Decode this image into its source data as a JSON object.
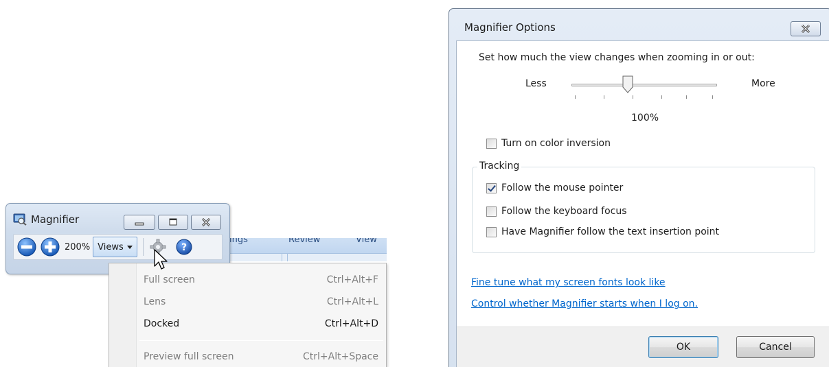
{
  "magnifier": {
    "title": "Magnifier",
    "zoom_level": "200%",
    "views_label": "Views"
  },
  "ribbon_bg": {
    "labels": [
      "ings",
      "Review",
      "View"
    ]
  },
  "views_menu": {
    "items": [
      {
        "label": "Full screen",
        "shortcut": "Ctrl+Alt+F",
        "enabled": false
      },
      {
        "label": "Lens",
        "shortcut": "Ctrl+Alt+L",
        "enabled": false
      },
      {
        "label": "Docked",
        "shortcut": "Ctrl+Alt+D",
        "enabled": true
      },
      {
        "label": "Preview full screen",
        "shortcut": "Ctrl+Alt+Space",
        "enabled": false
      }
    ]
  },
  "options_dialog": {
    "title": "Magnifier Options",
    "zoom_prompt": "Set how much the view changes when zooming in or out:",
    "slider": {
      "min_label": "Less",
      "max_label": "More",
      "value_label": "100%",
      "level": 0.4
    },
    "color_inversion": {
      "label": "Turn on color inversion",
      "checked": false
    },
    "tracking": {
      "legend": "Tracking",
      "options": [
        {
          "label": "Follow the mouse pointer",
          "checked": true
        },
        {
          "label": "Follow the keyboard focus",
          "checked": false
        },
        {
          "label": "Have Magnifier follow the text insertion point",
          "checked": false
        }
      ]
    },
    "links": [
      "Fine tune what my screen fonts look like",
      "Control whether Magnifier starts when I log on."
    ],
    "ok_label": "OK",
    "cancel_label": "Cancel"
  }
}
